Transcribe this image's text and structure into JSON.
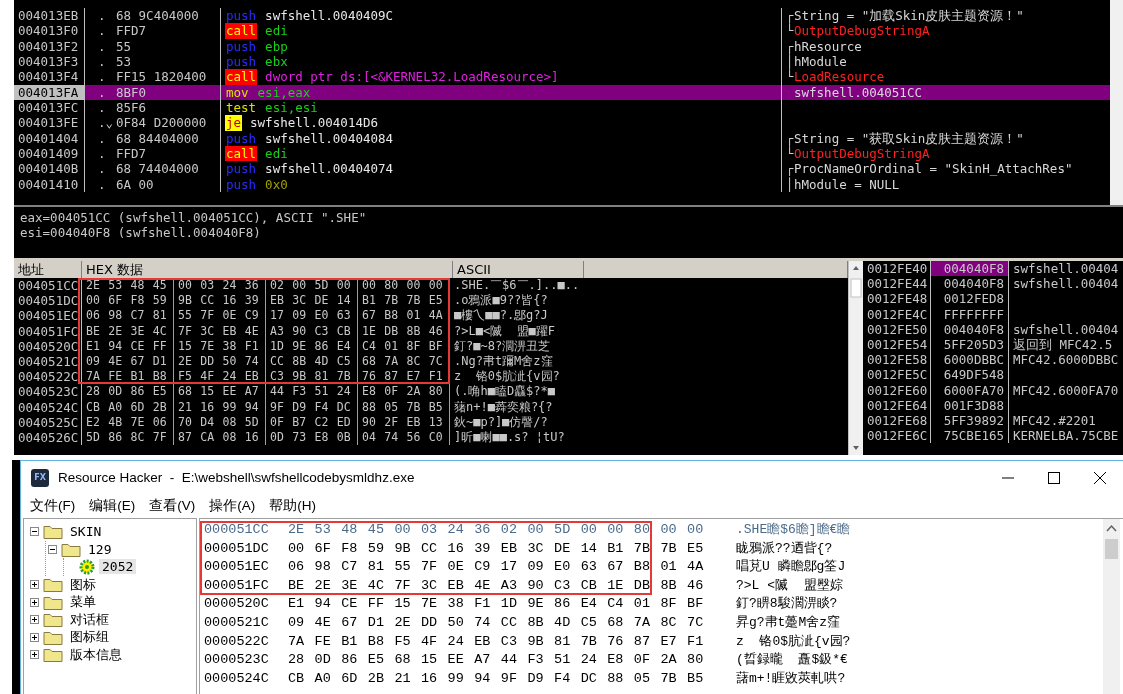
{
  "disassembly": {
    "rows": [
      {
        "address": "004013EB",
        "marker": ".",
        "bytes": "68 9C404000",
        "mnemonic": "push",
        "kind": "push",
        "operands": [
          {
            "text": "swfshell.0040409C",
            "kind": "address"
          }
        ],
        "selected": false,
        "comment": {
          "text": "String = \"加载Skin皮肤主题资源！\"",
          "kind": "note",
          "bracket": "┌"
        }
      },
      {
        "address": "004013F0",
        "marker": ".",
        "bytes": "FFD7",
        "mnemonic": "call",
        "kind": "call",
        "operands": [
          {
            "text": "edi",
            "kind": "register"
          }
        ],
        "selected": false,
        "comment": {
          "text": "OutputDebugStringA",
          "kind": "api",
          "bracket": "└"
        }
      },
      {
        "address": "004013F2",
        "marker": ".",
        "bytes": "55",
        "mnemonic": "push",
        "kind": "push",
        "operands": [
          {
            "text": "ebp",
            "kind": "register"
          }
        ],
        "selected": false,
        "comment": {
          "text": "hResource",
          "kind": "note",
          "bracket": "┌"
        }
      },
      {
        "address": "004013F3",
        "marker": ".",
        "bytes": "53",
        "mnemonic": "push",
        "kind": "push",
        "operands": [
          {
            "text": "ebx",
            "kind": "register"
          }
        ],
        "selected": false,
        "comment": {
          "text": "hModule",
          "kind": "note",
          "bracket": "│"
        }
      },
      {
        "address": "004013F4",
        "marker": ".",
        "bytes": "FF15 1820400",
        "mnemonic": "call",
        "kind": "call",
        "operands": [
          {
            "text": "dword ptr ds:[<&KERNEL32.LoadResource>]",
            "kind": "memory"
          }
        ],
        "selected": false,
        "comment": {
          "text": "LoadResource",
          "kind": "api",
          "bracket": "└"
        }
      },
      {
        "address": "004013FA",
        "marker": ".",
        "bytes": "8BF0",
        "mnemonic": "mov",
        "kind": "plain",
        "operands": [
          {
            "text": "esi,eax",
            "kind": "register"
          }
        ],
        "selected": true,
        "comment": {
          "text": "swfshell.004051CC",
          "kind": "note"
        }
      },
      {
        "address": "004013FC",
        "marker": ".",
        "bytes": "85F6",
        "mnemonic": "test",
        "kind": "plain",
        "operands": [
          {
            "text": "esi,esi",
            "kind": "register"
          }
        ],
        "selected": false
      },
      {
        "address": "004013FE",
        "marker": ".⌄",
        "bytes": "0F84 D200000",
        "mnemonic": "je",
        "kind": "jump",
        "operands": [
          {
            "text": "swfshell.004014D6",
            "kind": "address"
          }
        ],
        "selected": false
      },
      {
        "address": "00401404",
        "marker": ".",
        "bytes": "68 84404000",
        "mnemonic": "push",
        "kind": "push",
        "operands": [
          {
            "text": "swfshell.00404084",
            "kind": "address"
          }
        ],
        "selected": false,
        "comment": {
          "text": "String = \"获取Skin皮肤主题资源！\"",
          "kind": "note",
          "bracket": "┌"
        }
      },
      {
        "address": "00401409",
        "marker": ".",
        "bytes": "FFD7",
        "mnemonic": "call",
        "kind": "call",
        "operands": [
          {
            "text": "edi",
            "kind": "register"
          }
        ],
        "selected": false,
        "comment": {
          "text": "OutputDebugStringA",
          "kind": "api",
          "bracket": "└"
        }
      },
      {
        "address": "0040140B",
        "marker": ".",
        "bytes": "68 74404000",
        "mnemonic": "push",
        "kind": "push",
        "operands": [
          {
            "text": "swfshell.00404074",
            "kind": "address"
          }
        ],
        "selected": false,
        "comment": {
          "text": "ProcNameOrOrdinal = \"SkinH_AttachRes\"",
          "kind": "note",
          "bracket": "┌"
        }
      },
      {
        "address": "00401410",
        "marker": ".",
        "bytes": "6A 00",
        "mnemonic": "push",
        "kind": "push",
        "operands": [
          {
            "text": "0x0",
            "kind": "constant"
          }
        ],
        "selected": false,
        "comment": {
          "text": "hModule = NULL",
          "kind": "note",
          "bracket": "│"
        }
      }
    ]
  },
  "info": [
    "eax=004051CC (swfshell.004051CC), ASCII \".SHE\"",
    "esi=004040F8 (swfshell.004040F8)"
  ],
  "hex_dump": {
    "columns": [
      "地址",
      "HEX 数据",
      "ASCII"
    ],
    "rows": [
      {
        "address": "004051CC",
        "bytes": [
          "2E 53 48 45",
          "00 03 24 36",
          "02 00 5D 00",
          "00 80 00 00"
        ],
        "ascii": ".SHE.￣$6￣.]..■..",
        "boxed": true
      },
      {
        "address": "004051DC",
        "bytes": [
          "00 6F F8 59",
          "9B CC 16 39",
          "EB 3C DE 14",
          "B1 7B 7B E5"
        ],
        "ascii": ".o鴉派■9??皆{?",
        "boxed": true
      },
      {
        "address": "004051EC",
        "bytes": [
          "06 98 C7 81",
          "55 7F 0E C9",
          "17 09 E0 63",
          "67 B8 01 4A"
        ],
        "ascii": "■樓乀■■?.鄎g?J",
        "boxed": true
      },
      {
        "address": "004051FC",
        "bytes": [
          "BE 2E 3E 4C",
          "7F 3C EB 4E",
          "A3 90 C3 CB",
          "1E DB 8B 46"
        ],
        "ascii": "?>L■<隇  盟■躍F",
        "boxed": true
      },
      {
        "address": "0040520C",
        "bytes": [
          "E1 94 CE FF",
          "15 7E 38 F1",
          "1D 9E 86 E4",
          "C4 01 8F BF"
        ],
        "ascii": "釘?■~8?濶淠丑芝",
        "boxed": true
      },
      {
        "address": "0040521C",
        "bytes": [
          "09 4E 67 D1",
          "2E DD 50 74",
          "CC 8B 4D C5",
          "68 7A 8C 7C"
        ],
        "ascii": ".Ng?帇t躎M舍z窪",
        "boxed": true
      },
      {
        "address": "0040522C",
        "bytes": [
          "7A FE B1 B8",
          "F5 4F 24 EB",
          "C3 9B 81 7B",
          "76 87 E7 F1"
        ],
        "ascii": "z  铬0$肮泚{v园?",
        "boxed": true
      },
      {
        "address": "0040523C",
        "bytes": [
          "28 0D 86 E5",
          "68 15 EE A7",
          "44 F3 51 24",
          "E8 0F 2A 80"
        ],
        "ascii": "(.唃h■瞌D麤$?*■",
        "boxed": false
      },
      {
        "address": "0040524C",
        "bytes": [
          "CB A0 6D 2B",
          "21 16 99 94",
          "9F D9 F4 DC",
          "88 05 7B B5"
        ],
        "ascii": "蕏n+!■蕣奕粮?{?",
        "boxed": false
      },
      {
        "address": "0040525C",
        "bytes": [
          "E2 4B 7E 06",
          "70 D4 08 5D",
          "0F B7 C2 ED",
          "90 2F EB 13"
        ],
        "ascii": "鈥~■p?]■仿謦/?",
        "boxed": false
      },
      {
        "address": "0040526C",
        "bytes": [
          "5D 86 8C 7F",
          "87 CA 08 16",
          "0D 73 E8 0B",
          "04 74 56 C0"
        ],
        "ascii": "]昕■喇■■.s? ¦tU?",
        "boxed": false
      }
    ]
  },
  "stack": {
    "rows": [
      {
        "address": "0012FE40",
        "value": "004040F8",
        "comment": "swfshell.00404",
        "selected": true
      },
      {
        "address": "0012FE44",
        "value": "004040F8",
        "comment": "swfshell.00404",
        "selected": false
      },
      {
        "address": "0012FE48",
        "value": "0012FED8",
        "selected": false
      },
      {
        "address": "0012FE4C",
        "value": "FFFFFFFF",
        "selected": false
      },
      {
        "address": "0012FE50",
        "value": "004040F8",
        "comment": "swfshell.00404",
        "selected": false
      },
      {
        "address": "0012FE54",
        "value": "5FF205D3",
        "comment": "返回到 MFC42.5",
        "selected": false
      },
      {
        "address": "0012FE58",
        "value": "6000DBBC",
        "comment": "MFC42.6000DBBC",
        "selected": false
      },
      {
        "address": "0012FE5C",
        "value": "649DF548",
        "selected": false
      },
      {
        "address": "0012FE60",
        "value": "6000FA70",
        "comment": "MFC42.6000FA70",
        "selected": false
      },
      {
        "address": "0012FE64",
        "value": "001F3D88",
        "selected": false
      },
      {
        "address": "0012FE68",
        "value": "5FF39892",
        "comment": "MFC42.#2201",
        "selected": false
      },
      {
        "address": "0012FE6C",
        "value": "75CBE165",
        "comment": "KERNELBA.75CBE",
        "selected": false
      }
    ]
  },
  "resource_hacker": {
    "window": {
      "icon_text": "FX",
      "title": "Resource Hacker  -  E:\\webshell\\swfshellcodebysmldhz.exe"
    },
    "menu": [
      "文件(F)",
      "编辑(E)",
      "查看(V)",
      "操作(A)",
      "帮助(H)"
    ],
    "tree": [
      {
        "label": "SKIN",
        "kind": "folder",
        "expanded": true,
        "selected": false,
        "children": [
          {
            "label": "129",
            "kind": "folder",
            "expanded": true,
            "selected": false,
            "children": [
              {
                "label": "2052",
                "kind": "resource",
                "selected": true
              }
            ]
          }
        ]
      },
      {
        "label": "图标",
        "kind": "folder",
        "expanded": false,
        "selected": false
      },
      {
        "label": "菜单",
        "kind": "folder",
        "expanded": false,
        "selected": false
      },
      {
        "label": "对话框",
        "kind": "folder",
        "expanded": false,
        "selected": false
      },
      {
        "label": "图标组",
        "kind": "folder",
        "expanded": false,
        "selected": false
      },
      {
        "label": "版本信息",
        "kind": "folder",
        "expanded": false,
        "selected": false
      }
    ],
    "hex_rows": [
      {
        "address": "000051CC",
        "bytes": "2E 53 48 45 00 03 24 36 02 00 5D 00 00 80 00 00",
        "ascii": ".SHE瞻$6瞻]瞻€瞻",
        "selected": true,
        "boxed": true
      },
      {
        "address": "000051DC",
        "bytes": "00 6F F8 59 9B CC 16 39 EB 3C DE 14 B1 7B 7B E5",
        "ascii": "眬鴉派??迺眥{?",
        "selected": false,
        "boxed": true
      },
      {
        "address": "000051EC",
        "bytes": "06 98 C7 81 55 7F 0E C9 17 09 E0 63 67 B8 01 4A",
        "ascii": "唱莌U 瞵瞻鄎g筌J",
        "selected": false,
        "boxed": true
      },
      {
        "address": "000051FC",
        "bytes": "BE 2E 3E 4C 7F 3C EB 4E A3 90 C3 CB 1E DB 8B 46",
        "ascii": "?>L <隇  盟壂婃",
        "selected": false,
        "boxed": true
      },
      {
        "address": "0000520C",
        "bytes": "E1 94 CE FF 15 7E 38 F1 1D 9E 86 E4 C4 01 8F BF",
        "ascii": "釘?睤8駿濶淠睒?",
        "selected": false,
        "boxed": false
      },
      {
        "address": "0000521C",
        "bytes": "09 4E 67 D1 2E DD 50 74 CC 8B 4D C5 68 7A 8C 7C",
        "ascii": "昇g?帇t躉M舍z窪",
        "selected": false,
        "boxed": false
      },
      {
        "address": "0000522C",
        "bytes": "7A FE B1 B8 F5 4F 24 EB C3 9B 81 7B 76 87 E7 F1",
        "ascii": "z  铬0$肮泚{v园?",
        "selected": false,
        "boxed": false
      },
      {
        "address": "0000523C",
        "bytes": "28 0D 86 E5 68 15 EE A7 44 F3 51 24 E8 0F 2A 80",
        "ascii": "(晢録曨  矗$鈒*€",
        "selected": false,
        "boxed": false
      },
      {
        "address": "0000524C",
        "bytes": "CB A0 6D 2B 21 16 99 94 9F D9 F4 DC 88 05 7B B5",
        "ascii": "藷m+!睚敓莢軋哄?",
        "selected": false,
        "boxed": false
      }
    ]
  }
}
